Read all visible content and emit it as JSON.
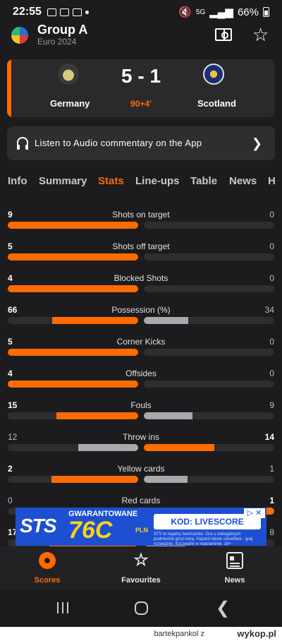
{
  "status_bar": {
    "time": "22:55",
    "signal": "5G",
    "battery": "66%"
  },
  "header": {
    "title": "Group A",
    "subtitle": "Euro 2024"
  },
  "match": {
    "score": "5 - 1",
    "minute": "90+4'",
    "home_team": "Germany",
    "away_team": "Scotland"
  },
  "audio": {
    "label": "Listen to Audio commentary on the App"
  },
  "tabs": [
    "Info",
    "Summary",
    "Stats",
    "Line-ups",
    "Table",
    "News",
    "H"
  ],
  "active_tab": "Stats",
  "stats": [
    {
      "label": "Shots on target",
      "home": "9",
      "away": "0",
      "home_pct": 1.0,
      "away_pct": 0.0,
      "leader": "home"
    },
    {
      "label": "Shots off target",
      "home": "5",
      "away": "0",
      "home_pct": 1.0,
      "away_pct": 0.0,
      "leader": "home"
    },
    {
      "label": "Blocked Shots",
      "home": "4",
      "away": "0",
      "home_pct": 1.0,
      "away_pct": 0.0,
      "leader": "home"
    },
    {
      "label": "Possession (%)",
      "home": "66",
      "away": "34",
      "home_pct": 0.66,
      "away_pct": 0.34,
      "leader": "home"
    },
    {
      "label": "Corner Kicks",
      "home": "5",
      "away": "0",
      "home_pct": 1.0,
      "away_pct": 0.0,
      "leader": "home"
    },
    {
      "label": "Offsides",
      "home": "4",
      "away": "0",
      "home_pct": 1.0,
      "away_pct": 0.0,
      "leader": "home"
    },
    {
      "label": "Fouls",
      "home": "15",
      "away": "9",
      "home_pct": 0.625,
      "away_pct": 0.375,
      "leader": "home"
    },
    {
      "label": "Throw ins",
      "home": "12",
      "away": "14",
      "home_pct": 0.46,
      "away_pct": 0.54,
      "leader": "away"
    },
    {
      "label": "Yellow cards",
      "home": "2",
      "away": "1",
      "home_pct": 0.667,
      "away_pct": 0.333,
      "leader": "home"
    },
    {
      "label": "Red cards",
      "home": "0",
      "away": "1",
      "home_pct": 0.0,
      "away_pct": 1.0,
      "leader": "away"
    },
    {
      "label": "",
      "home": "17",
      "away": "8",
      "home_pct": 0.68,
      "away_pct": 0.32,
      "leader": "home"
    }
  ],
  "ad": {
    "brand": "STS",
    "headline": "GWARANTOWANE",
    "amount": "76C",
    "currency": "PLN",
    "code": "KOD: LIVESCORE",
    "fine_print": "STS to legalny bukmacher. Gra u nielegalnych podmiotów grozi karą. Hazard niesie szkodliwe - graj rozważnie. Szczegóły w regulaminie. 18+",
    "close": "▷ ✕"
  },
  "bottom_nav": [
    {
      "label": "Scores",
      "icon": "soccer-ball-icon"
    },
    {
      "label": "Favourites",
      "icon": "star-icon"
    },
    {
      "label": "News",
      "icon": "newspaper-icon"
    }
  ],
  "footer": {
    "user": "bartekpankol",
    "separator": "z",
    "site": "wykop.pl"
  },
  "colors": {
    "accent": "#ff6b00",
    "loser_bar": "#a9a9ad",
    "background": "#1c1c1e"
  }
}
